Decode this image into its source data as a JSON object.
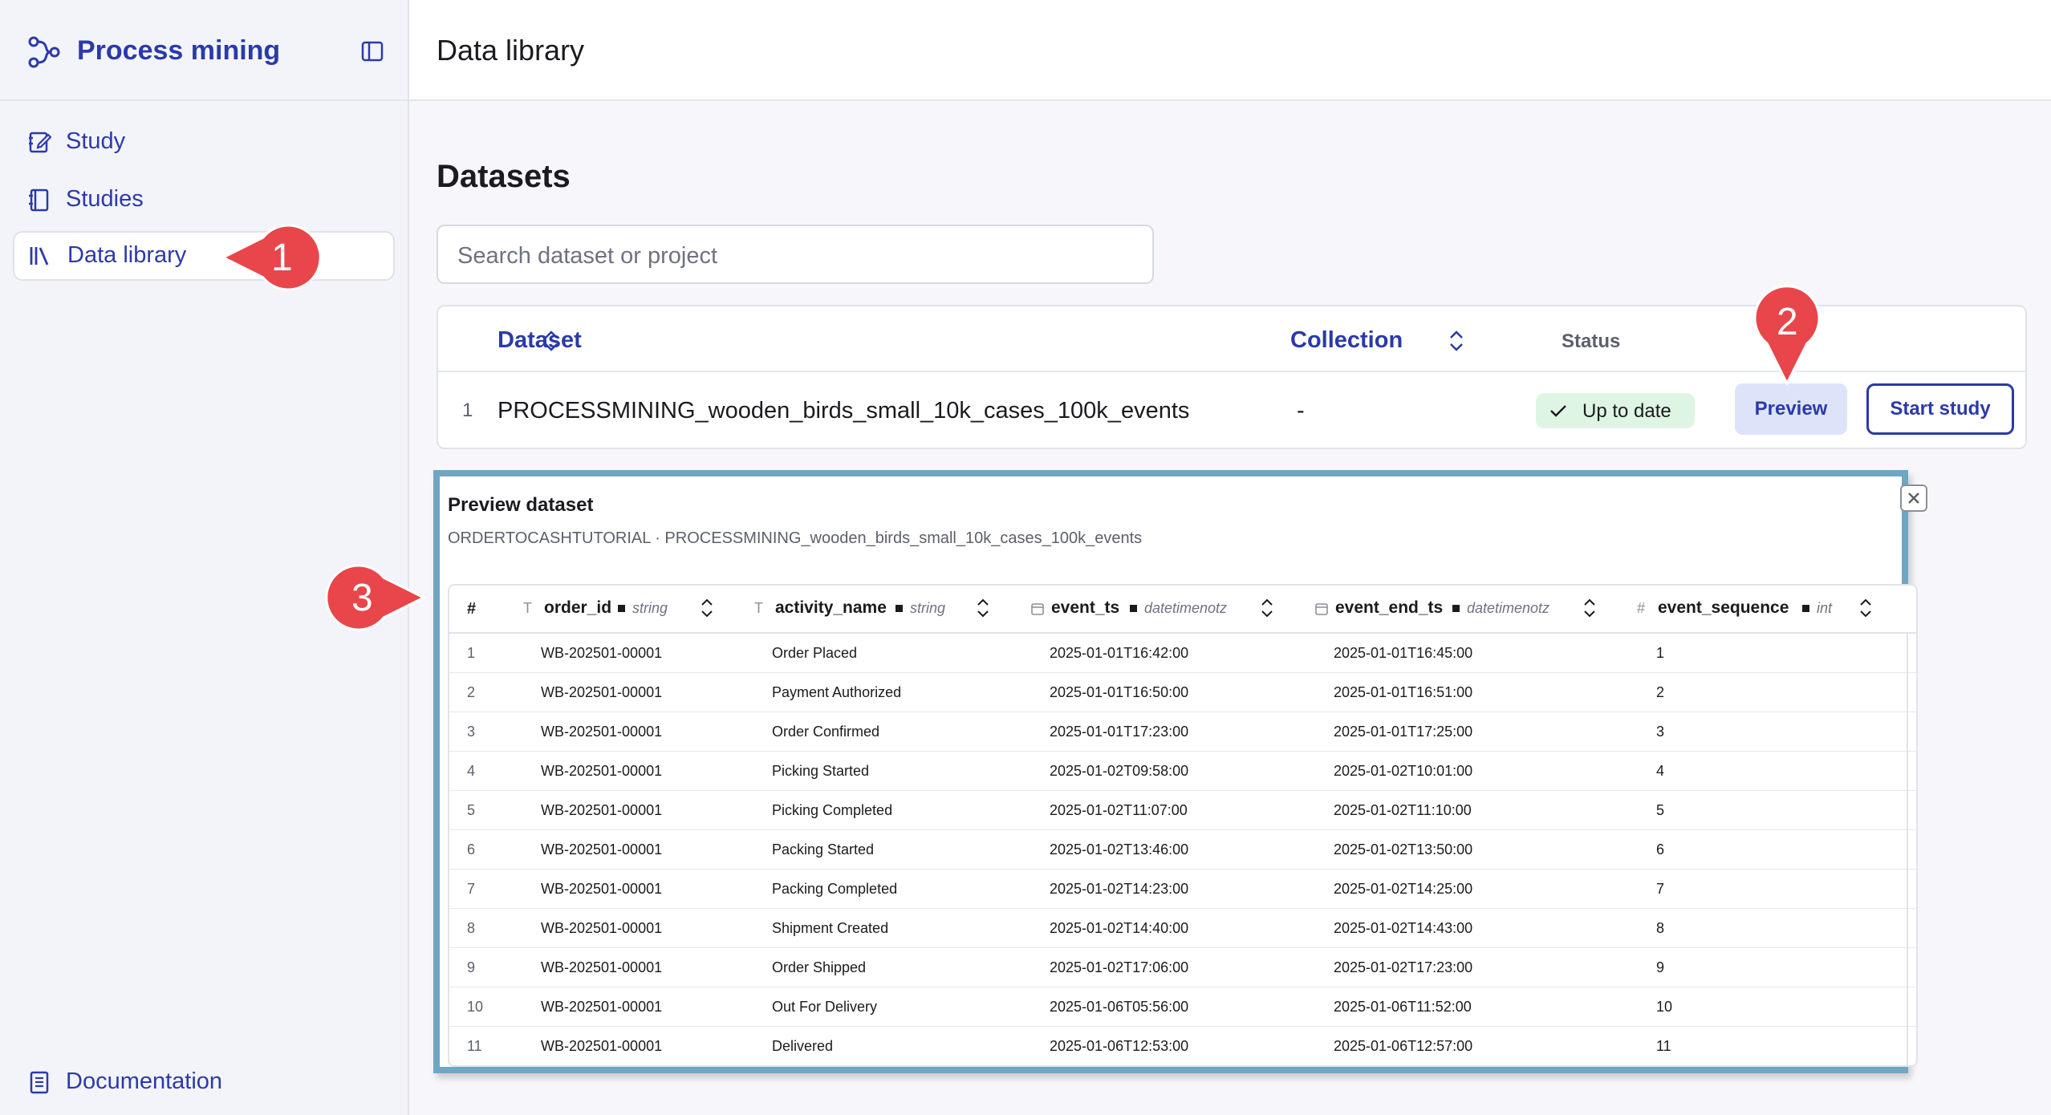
{
  "sidebar": {
    "brand": "Process mining",
    "items": [
      {
        "label": "Study",
        "icon": "edit-notebook-icon"
      },
      {
        "label": "Studies",
        "icon": "notebook-icon"
      },
      {
        "label": "Data library",
        "icon": "library-icon"
      }
    ],
    "footer_item": {
      "label": "Documentation",
      "icon": "document-icon"
    }
  },
  "header": {
    "title": "Data library"
  },
  "datasets": {
    "title": "Datasets",
    "search_placeholder": "Search dataset or project",
    "columns": {
      "dataset": "Dataset",
      "collection": "Collection",
      "status": "Status"
    },
    "rows": [
      {
        "index": "1",
        "name": "PROCESSMINING_wooden_birds_small_10k_cases_100k_events",
        "collection": "-",
        "status": "Up to date",
        "preview_label": "Preview",
        "start_label": "Start study"
      }
    ]
  },
  "preview": {
    "title": "Preview dataset",
    "subtitle": "ORDERTOCASHTUTORIAL · PROCESSMINING_wooden_birds_small_10k_cases_100k_events",
    "columns": [
      {
        "name": "#",
        "type": ""
      },
      {
        "name": "order_id",
        "type": "string",
        "icon": "T"
      },
      {
        "name": "activity_name",
        "type": "string",
        "icon": "T"
      },
      {
        "name": "event_ts",
        "type": "datetimenotz",
        "icon": "calendar"
      },
      {
        "name": "event_end_ts",
        "type": "datetimenotz",
        "icon": "calendar"
      },
      {
        "name": "event_sequence",
        "type": "int",
        "icon": "#"
      }
    ],
    "rows": [
      [
        "1",
        "WB-202501-00001",
        "Order Placed",
        "2025-01-01T16:42:00",
        "2025-01-01T16:45:00",
        "1"
      ],
      [
        "2",
        "WB-202501-00001",
        "Payment Authorized",
        "2025-01-01T16:50:00",
        "2025-01-01T16:51:00",
        "2"
      ],
      [
        "3",
        "WB-202501-00001",
        "Order Confirmed",
        "2025-01-01T17:23:00",
        "2025-01-01T17:25:00",
        "3"
      ],
      [
        "4",
        "WB-202501-00001",
        "Picking Started",
        "2025-01-02T09:58:00",
        "2025-01-02T10:01:00",
        "4"
      ],
      [
        "5",
        "WB-202501-00001",
        "Picking Completed",
        "2025-01-02T11:07:00",
        "2025-01-02T11:10:00",
        "5"
      ],
      [
        "6",
        "WB-202501-00001",
        "Packing Started",
        "2025-01-02T13:46:00",
        "2025-01-02T13:50:00",
        "6"
      ],
      [
        "7",
        "WB-202501-00001",
        "Packing Completed",
        "2025-01-02T14:23:00",
        "2025-01-02T14:25:00",
        "7"
      ],
      [
        "8",
        "WB-202501-00001",
        "Shipment Created",
        "2025-01-02T14:40:00",
        "2025-01-02T14:43:00",
        "8"
      ],
      [
        "9",
        "WB-202501-00001",
        "Order Shipped",
        "2025-01-02T17:06:00",
        "2025-01-02T17:23:00",
        "9"
      ],
      [
        "10",
        "WB-202501-00001",
        "Out For Delivery",
        "2025-01-06T05:56:00",
        "2025-01-06T11:52:00",
        "10"
      ],
      [
        "11",
        "WB-202501-00001",
        "Delivered",
        "2025-01-06T12:53:00",
        "2025-01-06T12:57:00",
        "11"
      ]
    ]
  },
  "callouts": [
    "1",
    "2",
    "3"
  ],
  "colors": {
    "accent": "#2b3aa8",
    "callout": "#e8464a",
    "preview_border": "#6fa6c3",
    "status_bg": "#dff5e4"
  }
}
